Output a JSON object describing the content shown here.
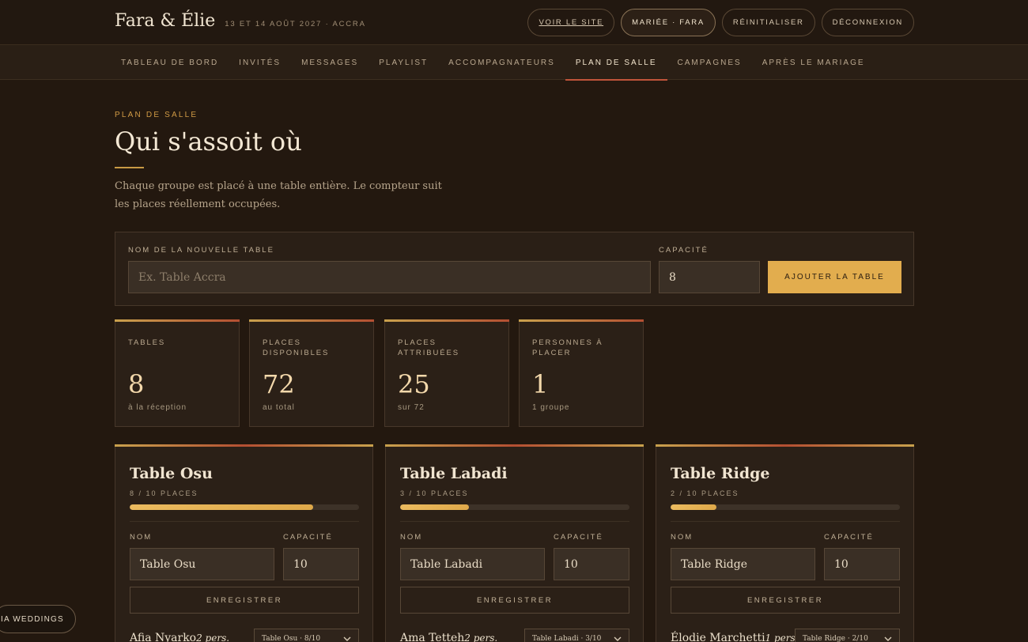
{
  "header": {
    "brand": "Fara & Élie",
    "event_date": "13 ET 14 AOÛT 2027 · ACCRA",
    "actions": [
      "VOIR LE SITE",
      "MARIÉE · FARA",
      "RÉINITIALISER",
      "DÉCONNEXION"
    ]
  },
  "nav": {
    "items": [
      "TABLEAU DE BORD",
      "INVITÉS",
      "MESSAGES",
      "PLAYLIST",
      "ACCOMPAGNATEURS",
      "PLAN DE SALLE",
      "CAMPAGNES",
      "APRÈS LE MARIAGE"
    ],
    "active": "PLAN DE SALLE"
  },
  "page": {
    "eyebrow": "PLAN DE SALLE",
    "title": "Qui s'assoit où",
    "intro": "Chaque groupe est placé à une table entière. Le compteur suit les places réellement occupées."
  },
  "add_table": {
    "name_label": "NOM DE LA NOUVELLE TABLE",
    "name_placeholder": "Ex. Table Accra",
    "capacity_label": "CAPACITÉ",
    "capacity_value": "8",
    "button_label": "AJOUTER LA TABLE"
  },
  "stats": [
    {
      "label": "TABLES",
      "value": "8",
      "sub": "à la réception"
    },
    {
      "label": "PLACES DISPONIBLES",
      "value": "72",
      "sub": "au total"
    },
    {
      "label": "PLACES ATTRIBUÉES",
      "value": "25",
      "sub": "sur 72"
    },
    {
      "label": "PERSONNES À PLACER",
      "value": "1",
      "sub": "1 groupe"
    }
  ],
  "tables": [
    {
      "title": "Table Osu",
      "count": "8 / 10 PLACES",
      "fill": 0.8,
      "name_label": "NOM",
      "capacity_label": "CAPACITÉ",
      "name_value": "Table Osu",
      "capacity_value": "10",
      "save_label": "ENREGISTRER",
      "guest": "Afia Nyarko",
      "guest_count": "2 pers.",
      "assignment": "Table Osu · 8/10"
    },
    {
      "title": "Table Labadi",
      "count": "3 / 10 PLACES",
      "fill": 0.3,
      "name_label": "NOM",
      "capacity_label": "CAPACITÉ",
      "name_value": "Table Labadi",
      "capacity_value": "10",
      "save_label": "ENREGISTRER",
      "guest": "Ama Tetteh",
      "guest_count": "2 pers.",
      "assignment": "Table Labadi · 3/10"
    },
    {
      "title": "Table Ridge",
      "count": "2 / 10 PLACES",
      "fill": 0.2,
      "name_label": "NOM",
      "capacity_label": "CAPACITÉ",
      "name_value": "Table Ridge",
      "capacity_value": "10",
      "save_label": "ENREGISTRER",
      "guest": "Élodie Marchetti",
      "guest_count": "1 pers.",
      "assignment": "Table Ridge · 2/10"
    }
  ],
  "floating_badge": "IA WEDDINGS",
  "colors": {
    "background": "#23180f",
    "accent_gold": "#e2ad4e",
    "accent_red": "#c0543a"
  }
}
